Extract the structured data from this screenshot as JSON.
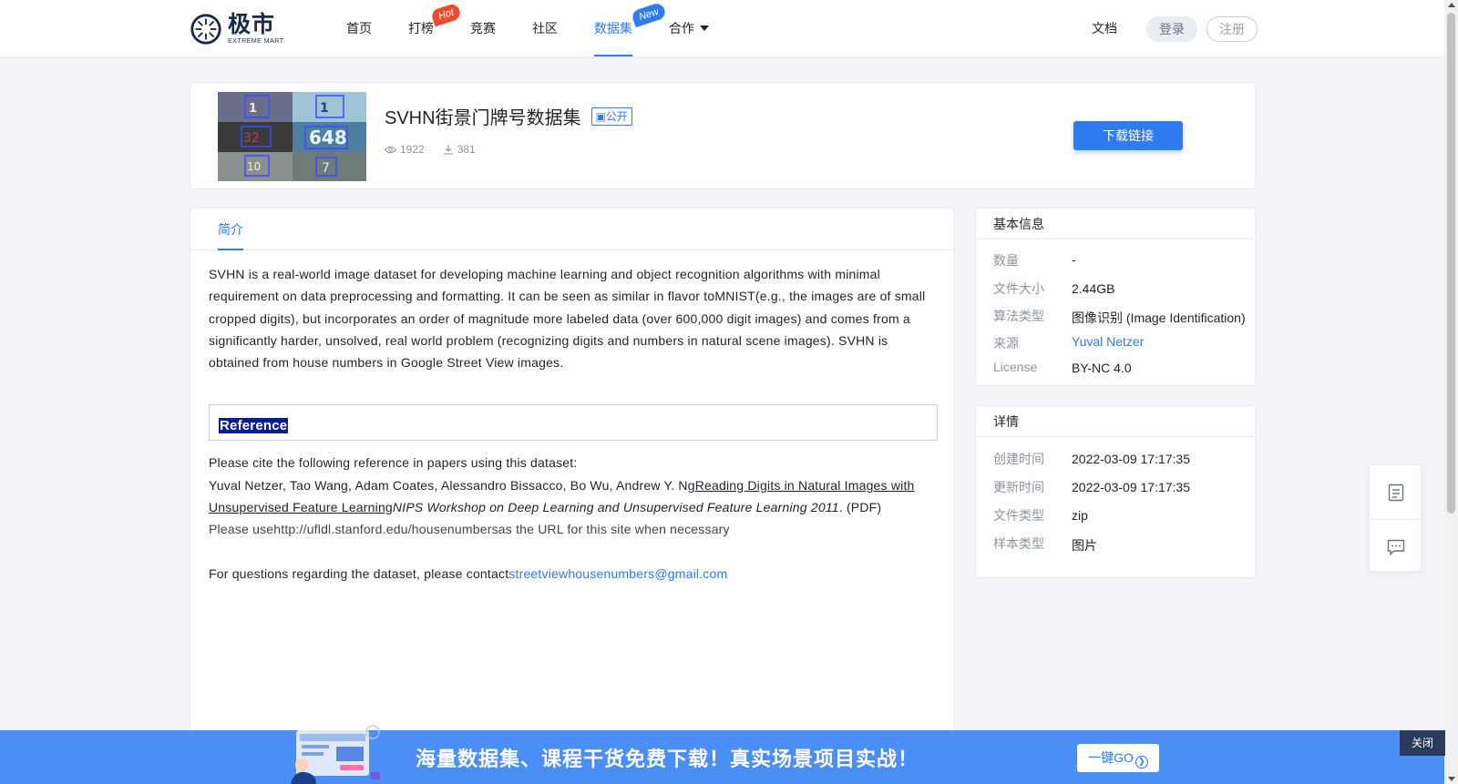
{
  "header": {
    "logo_cn": "极市",
    "logo_en": "EXTREME MART",
    "nav": [
      {
        "label": "首页",
        "badge": ""
      },
      {
        "label": "打榜",
        "badge": "Hot"
      },
      {
        "label": "竞赛",
        "badge": ""
      },
      {
        "label": "社区",
        "badge": ""
      },
      {
        "label": "数据集",
        "badge": "New"
      },
      {
        "label": "合作",
        "badge": ""
      }
    ],
    "docs": "文档",
    "login": "登录",
    "register": "注册"
  },
  "dataset": {
    "title": "SVHN街景门牌号数据集",
    "visibility": "公开",
    "views": "1922",
    "downloads": "381",
    "download_button": "下载链接"
  },
  "intro": {
    "tab": "简介",
    "paragraph": "SVHN is a real-world image dataset for developing machine learning and object recognition algorithms with minimal requirement on data preprocessing and formatting. It can be seen as similar in flavor toMNIST(e.g., the images are of small cropped digits), but incorporates an order of magnitude more labeled data (over 600,000 digit images) and comes from a significantly harder, unsolved, real world problem (recognizing digits and numbers in natural scene images). SVHN is obtained from house numbers in Google Street View images.",
    "reference_title": "Reference",
    "cite_intro": "Please cite the following reference in papers using this dataset:",
    "cite_authors": "Yuval Netzer, Tao Wang, Adam Coates, Alessandro Bissacco, Bo Wu, Andrew Y. Ng",
    "cite_paper": "Reading Digits in Natural Images with Unsupervised Feature Learning",
    "cite_venue": "NIPS Workshop on Deep Learning and Unsupervised Feature Learning 2011",
    "cite_pdf": ". (PDF)",
    "url_line": "Please usehttp://ufldl.stanford.edu/housenumbersas the URL for this site when necessary",
    "contact_prefix": "For questions regarding the dataset, please contact",
    "contact_email": "streetviewhousenumbers@gmail.com"
  },
  "basic_info": {
    "title": "基本信息",
    "rows": [
      {
        "label": "数量",
        "value": "-"
      },
      {
        "label": "文件大小",
        "value": "2.44GB"
      },
      {
        "label": "算法类型",
        "value": "图像识别 (Image Identification)"
      },
      {
        "label": "来源",
        "value": "Yuval Netzer"
      },
      {
        "label": "License",
        "value": "BY-NC 4.0"
      }
    ]
  },
  "details": {
    "title": "详情",
    "rows": [
      {
        "label": "创建时间",
        "value": "2022-03-09 17:17:35"
      },
      {
        "label": "更新时间",
        "value": "2022-03-09 17:17:35"
      },
      {
        "label": "文件类型",
        "value": "zip"
      },
      {
        "label": "样本类型",
        "value": "图片"
      }
    ]
  },
  "banner": {
    "text": "海量数据集、课程干货免费下载！真实场景项目实战！",
    "go_button": "一键GO",
    "close": "关闭"
  },
  "colors": {
    "accent": "#2f7bf2",
    "hot_badge": "#f04a2d",
    "banner_bg": "#4b8ef6",
    "close_bg": "#2a3a5c"
  },
  "icons": [
    "logo-icon",
    "eye-icon",
    "download-icon",
    "document-icon",
    "comment-icon",
    "chevron-right-icon",
    "caret-down-icon"
  ]
}
